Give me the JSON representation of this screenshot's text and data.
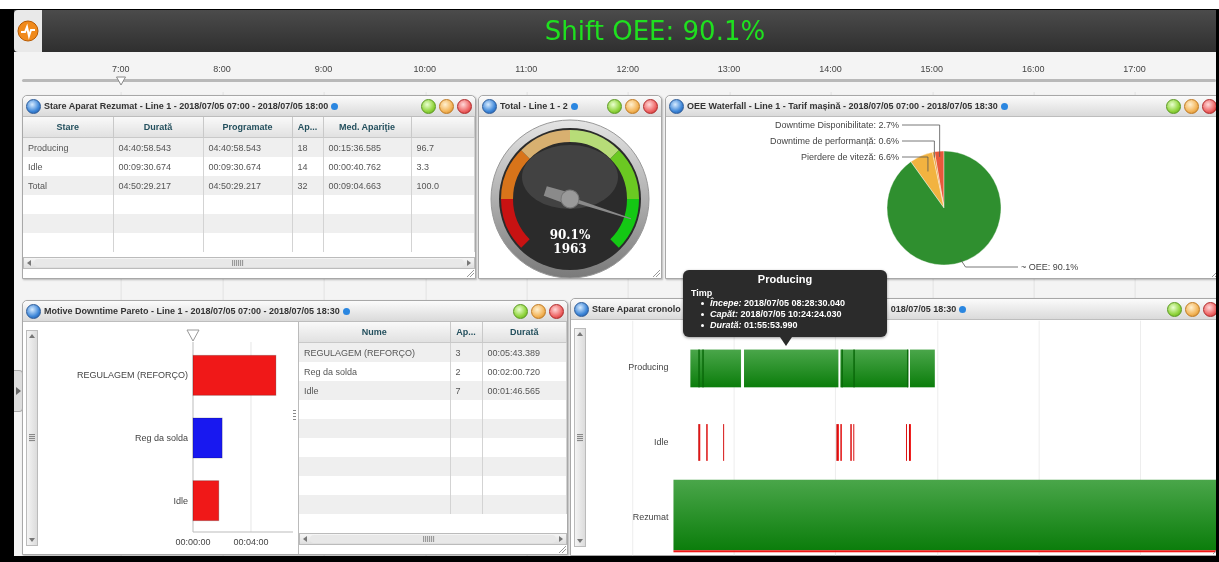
{
  "header": {
    "title": "Shift OEE: 90.1%"
  },
  "timeline": {
    "ticks": [
      "7:00",
      "8:00",
      "9:00",
      "10:00",
      "11:00",
      "12:00",
      "13:00",
      "14:00",
      "15:00",
      "16:00",
      "17:00"
    ],
    "level": 0.083
  },
  "panels": [
    {
      "kind": "table",
      "title": "Stare Aparat Rezumat - Line 1 - 2018/07/05 07:00 - 2018/07/05 18:00",
      "columns": [
        "Stare",
        "Durată",
        "Programate",
        "Ap...",
        "Med. Apariţie"
      ],
      "rows": [
        [
          "Producing",
          "04:40:58.543",
          "04:40:58.543",
          "18",
          "00:15:36.585",
          "96.7"
        ],
        [
          "Idle",
          "00:09:30.674",
          "00:09:30.674",
          "14",
          "00:00:40.762",
          "3.3"
        ],
        [
          "Total",
          "04:50:29.217",
          "04:50:29.217",
          "32",
          "00:09:04.663",
          "100.0"
        ]
      ]
    },
    {
      "kind": "gauge",
      "title": "Total - Line 1 - 2",
      "value": "90.1%",
      "count": "1963"
    },
    {
      "kind": "pie",
      "title": "OEE Waterfall - Line 1 - Tarif mașină - 2018/07/05 07:00 - 2018/07/05 18:30",
      "chart_data": {
        "type": "pie",
        "series": [
          {
            "values": [
              2.7,
              0.6,
              6.6,
              90.1
            ]
          }
        ],
        "colors": [
          "#e8583a",
          "#e89a3a",
          "#f2b340",
          "#2f8f2f"
        ],
        "value_labels": [
          "Downtime Disponibilitate: 2.7%",
          "Downtime de performanță: 0.6%",
          "Pierdere de viteză: 6.6%",
          "~ OEE: 90.1%"
        ]
      }
    },
    {
      "kind": "pareto",
      "title": "Motive Downtime Pareto - Line 1 - 2018/07/05 07:00 - 2018/07/05 18:30",
      "chart_data": {
        "type": "bar",
        "orientation": "horizontal",
        "categories": [
          "REGULAGEM (REFORÇO)",
          "Reg da solda",
          "Idle"
        ],
        "series": [
          {
            "values": [
              5.72,
              2.01,
              1.78
            ]
          }
        ],
        "colors": [
          "#f01818",
          "#1818f0",
          "#f01818"
        ],
        "xlim": [
          0,
          6.9
        ],
        "xticks": [
          {
            "value": 0,
            "label": "00:00:00"
          },
          {
            "value": 4,
            "label": "00:04:00"
          }
        ]
      },
      "columns": [
        "Nume",
        "Ap...",
        "Durată"
      ],
      "rows": [
        [
          "REGULAGEM (REFORÇO)",
          "3",
          "00:05:43.389"
        ],
        [
          "Reg da solda",
          "2",
          "00:02:00.720"
        ],
        [
          "Idle",
          "7",
          "00:01:46.565"
        ]
      ]
    },
    {
      "kind": "states",
      "title": "Stare Aparat cronolo",
      "title_end": "018/07/05 18:30",
      "rows": [
        "Producing",
        "Idle",
        "Rezumat"
      ]
    }
  ],
  "tooltip": {
    "title": "Producing",
    "heading": "Timp",
    "items": [
      "*Începe:* 2018/07/05 08:28:30.040",
      "*Capăt:* 2018/07/05 10:24:24.030",
      "*Durată:* 01:55:53.990"
    ]
  }
}
